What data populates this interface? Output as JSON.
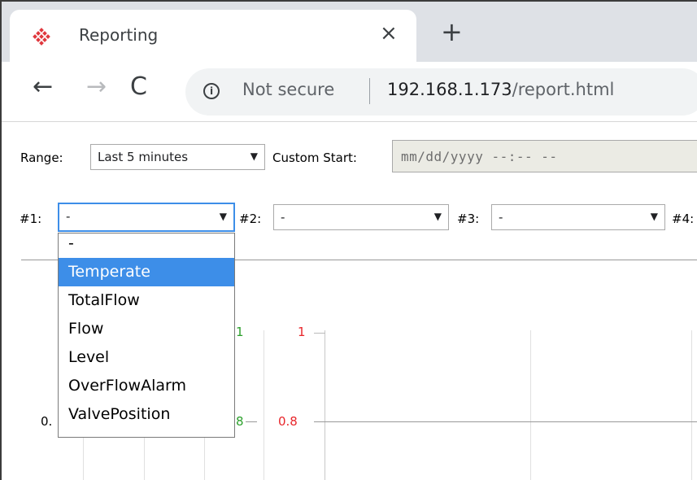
{
  "browser": {
    "tab_title": "Reporting",
    "tab_close_glyph": "×",
    "new_tab_glyph": "+",
    "back_glyph": "←",
    "forward_glyph": "→",
    "reload_glyph": "C",
    "info_glyph": "i",
    "security_label": "Not secure",
    "url_host": "192.168.1.173",
    "url_path": "/report.html"
  },
  "controls": {
    "range_label": "Range:",
    "range_value": "Last 5 minutes",
    "custom_start_label": "Custom Start:",
    "custom_start_placeholder": "mm/dd/yyyy --:-- --",
    "selects": [
      {
        "label": "#1:",
        "value": "-"
      },
      {
        "label": "#2:",
        "value": "-"
      },
      {
        "label": "#3:",
        "value": "-"
      },
      {
        "label": "#4:",
        "value": ""
      }
    ],
    "arrow_glyph": "▼"
  },
  "dropdown": {
    "options": [
      "-",
      "Temperate",
      "TotalFlow",
      "Flow",
      "Level",
      "OverFlowAlarm",
      "ValvePosition"
    ],
    "selected_index": 1
  },
  "chart": {
    "ticks_left_black": [
      "0."
    ],
    "ticks_green": [
      "1",
      "8"
    ],
    "ticks_red": [
      "1",
      "0.8"
    ],
    "colors": {
      "green": "#2ca02c",
      "red": "#e8262b",
      "black": "#000000",
      "accent": "#3d8ee8"
    }
  }
}
